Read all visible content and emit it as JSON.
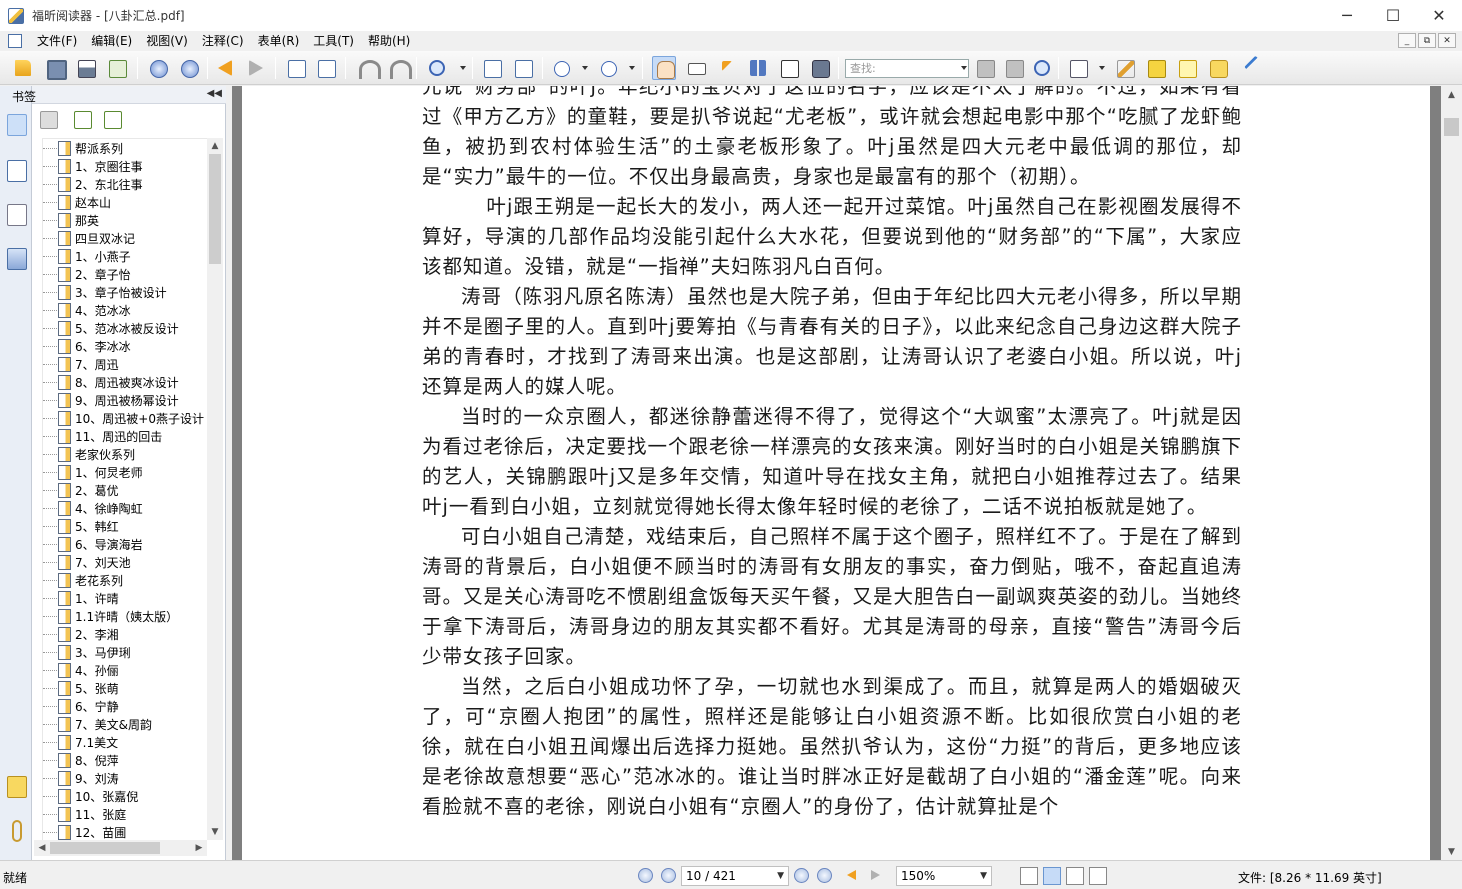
{
  "window": {
    "title": "福昕阅读器 - [八卦汇总.pdf]",
    "minimize": "─",
    "maximize": "☐",
    "close": "✕"
  },
  "menu": [
    "文件(F)",
    "编辑(E)",
    "视图(V)",
    "注释(C)",
    "表单(R)",
    "工具(T)",
    "帮助(H)"
  ],
  "mdi": {
    "minimize": "_",
    "restore": "⧉",
    "close": "✕"
  },
  "toolbar": {
    "search_placeholder": "查找:"
  },
  "bookmarks": {
    "title": "书签",
    "collapse": "◀◀",
    "items": [
      "帮派系列",
      "1、京圈往事",
      "2、东北往事",
      "赵本山",
      "那英",
      "四旦双冰记",
      "1、小燕子",
      "2、章子怡",
      "3、章子怡被设计",
      "4、范冰冰",
      "5、范冰冰被反设计",
      "6、李冰冰",
      "7、周迅",
      "8、周迅被爽冰设计",
      "9、周迅被杨幂设计",
      "10、周迅被+0燕子设计",
      "11、周迅的回击",
      "老家伙系列",
      "1、何炅老师",
      "2、葛优",
      "4、徐峥陶虹",
      "5、韩红",
      "6、导演海岩",
      "7、刘天池",
      "老花系列",
      "1、许晴",
      "1.1许晴（姨太版）",
      "2、李湘",
      "3、马伊琍",
      "4、孙俪",
      "5、张萌",
      "6、宁静",
      "7、美文&周韵",
      "7.1美文",
      "8、倪萍",
      "9、刘涛",
      "10、张嘉倪",
      "11、张庭",
      "12、苗圃"
    ]
  },
  "document": {
    "paragraphs": [
      {
        "style": "plain",
        "text": "元说“财务部”的叶j。年纪小的宝贝对于这位的名字，应该是不太了解的。不过，如果有看过《甲方乙方》的童鞋，要是扒爷说起“尤老板”，或许就会想起电影中那个“吃腻了龙虾鲍鱼，被扔到农村体验生活”的土豪老板形象了。叶j虽然是四大元老中最低调的那位，却是“实力”最牛的一位。不仅出身最高贵，身家也是最富有的那个（初期）。"
      },
      {
        "style": "indent3",
        "text": "叶j跟王朔是一起长大的发小，两人还一起开过菜馆。叶j虽然自己在影视圈发展得不算好，导演的几部作品均没能引起什么大水花，但要说到他的“财务部”的“下属”，大家应该都知道。没错，就是“一指禅”夫妇陈羽凡白百何。"
      },
      {
        "style": "indent",
        "text": "涛哥（陈羽凡原名陈涛）虽然也是大院子弟，但由于年纪比四大元老小得多，所以早期并不是圈子里的人。直到叶j要筹拍《与青春有关的日子》，以此来纪念自己身边这群大院子弟的青春时，才找到了涛哥来出演。也是这部剧，让涛哥认识了老婆白小姐。所以说，叶j还算是两人的媒人呢。"
      },
      {
        "style": "indent",
        "text": "当时的一众京圈人，都迷徐静蕾迷得不得了，觉得这个“大飒蜜”太漂亮了。叶j就是因为看过老徐后，决定要找一个跟老徐一样漂亮的女孩来演。刚好当时的白小姐是关锦鹏旗下的艺人，关锦鹏跟叶j又是多年交情，知道叶导在找女主角，就把白小姐推荐过去了。结果叶j一看到白小姐，立刻就觉得她长得太像年轻时候的老徐了，二话不说拍板就是她了。"
      },
      {
        "style": "indent",
        "text": "可白小姐自己清楚，戏结束后，自己照样不属于这个圈子，照样红不了。于是在了解到涛哥的背景后，白小姐便不顾当时的涛哥有女朋友的事实，奋力倒贴，哦不，奋起直追涛哥。又是关心涛哥吃不惯剧组盒饭每天买午餐，又是大胆告白一副飒爽英姿的劲儿。当她终于拿下涛哥后，涛哥身边的朋友其实都不看好。尤其是涛哥的母亲，直接“警告”涛哥今后少带女孩子回家。"
      },
      {
        "style": "indent",
        "text": "当然，之后白小姐成功怀了孕，一切就也水到渠成了。而且，就算是两人的婚姻破灭了，可“京圈人抱团”的属性，照样还是能够让白小姐资源不断。比如很欣赏白小姐的老徐，就在白小姐丑闻爆出后选择力挺她。虽然扒爷认为，这份“力挺”的背后，更多地应该是老徐故意想要“恶心”范冰冰的。谁让当时胖冰正好是截胡了白小姐的“潘金莲”呢。向来看脸就不喜的老徐，刚说白小姐有“京圈人”的身份了，估计就算扯是个"
      }
    ]
  },
  "status": {
    "ready": "就绪",
    "page": "10 / 421",
    "zoom": "150%",
    "file_size": "文件: [8.26 * 11.69 英寸]"
  }
}
